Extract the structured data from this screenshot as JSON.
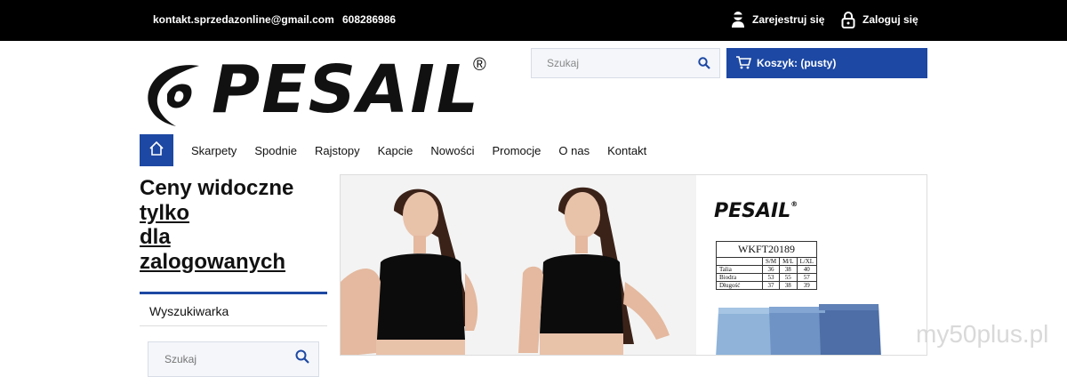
{
  "topbar": {
    "email": "kontakt.sprzedazonline@gmail.com",
    "phone": "608286986",
    "register_label": "Zarejestruj się",
    "login_label": "Zaloguj się"
  },
  "logo": {
    "text": "PESAIL",
    "mark": "®"
  },
  "search": {
    "placeholder": "Szukaj"
  },
  "cart": {
    "label": "Koszyk: (pusty)"
  },
  "nav": {
    "items": [
      "Skarpety",
      "Spodnie",
      "Rajstopy",
      "Kapcie",
      "Nowości",
      "Promocje",
      "O nas",
      "Kontakt"
    ]
  },
  "sidebar": {
    "title_line1": "Ceny widoczne",
    "title_line2": "tylko",
    "title_line3": "dla",
    "title_line4": "zalogowanych",
    "section_label": "Wyszukiwarka",
    "search_placeholder": "Szukaj"
  },
  "banner": {
    "brand": "PESAIL",
    "brand_mark": "®",
    "product_code": "WKFT20189",
    "size_headers": [
      "S/M",
      "M/L",
      "L/XL"
    ],
    "rows": [
      {
        "label": "Talia",
        "values": [
          "36",
          "38",
          "40"
        ]
      },
      {
        "label": "Biodra",
        "values": [
          "53",
          "55",
          "57"
        ]
      },
      {
        "label": "Długość",
        "values": [
          "37",
          "38",
          "39"
        ]
      }
    ]
  },
  "watermark": "my50plus.pl",
  "colors": {
    "accent": "#1d48a3",
    "topbar": "#000000"
  }
}
